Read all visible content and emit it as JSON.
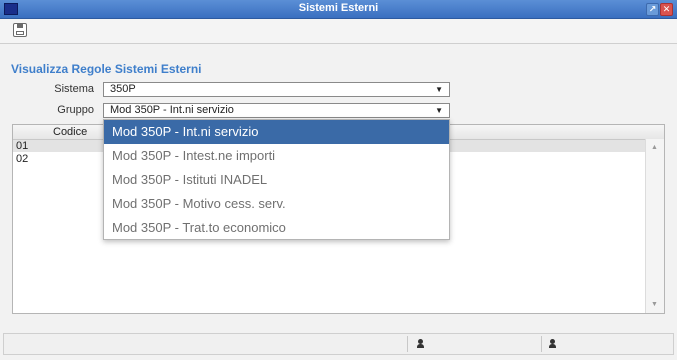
{
  "window": {
    "title": "Sistemi Esterni"
  },
  "toolbar": {
    "save_icon": "floppy-disk-icon"
  },
  "form": {
    "section_title": "Visualizza Regole Sistemi Esterni",
    "sistema_label": "Sistema",
    "sistema_value": "350P",
    "gruppo_label": "Gruppo",
    "gruppo_value": "Mod 350P - Int.ni servizio"
  },
  "grid": {
    "columns": [
      "Codice"
    ],
    "rows": [
      {
        "codice": "01"
      },
      {
        "codice": "02"
      }
    ]
  },
  "dropdown": {
    "options": [
      "Mod 350P - Int.ni servizio",
      "Mod 350P - Intest.ne importi",
      "Mod 350P - Istituti INADEL",
      "Mod 350P - Motivo cess. serv.",
      "Mod 350P - Trat.to economico"
    ],
    "selected_index": 0
  },
  "colors": {
    "accent": "#3f7fcb",
    "selected_bg": "#3a6aa7"
  }
}
